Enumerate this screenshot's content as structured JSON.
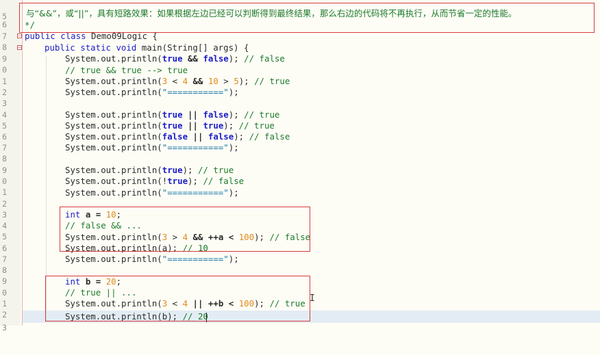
{
  "editor": {
    "lines": [
      {
        "num": "5"
      },
      {
        "num": "6",
        "comment": "与“&&”，或“||”，具有短路效果：如果根据左边已经可以判断得到最终结果，那么右边的代码将不再执行，从而节省一定的性能。"
      },
      {
        "num": "7",
        "text": "*/"
      },
      {
        "num": "8",
        "kw1": "public",
        "kw2": "class",
        "text": "Demo09Logic {"
      },
      {
        "num": "9",
        "kw1": "public",
        "kw2": "static",
        "kw3": "void",
        "text": "main(String[] args) {"
      },
      {
        "num": "0",
        "pre": "System.out.println(",
        "a": "true",
        "op": " && ",
        "b": "false",
        "post": "); ",
        "c": "// false"
      },
      {
        "num": "1",
        "c": "// true && true --> true"
      },
      {
        "num": "2",
        "pre": "System.out.println(",
        "n1": "3",
        "t1": " < ",
        "n2": "4",
        "t2": " && ",
        "n3": "10",
        "t3": " > ",
        "n4": "5",
        "post": "); ",
        "c": "// true"
      },
      {
        "num": "3",
        "pre": "System.out.println(",
        "s": "\"===========\"",
        "post": ");"
      },
      {
        "num": "4"
      },
      {
        "num": "5",
        "pre": "System.out.println(",
        "a": "true",
        "op": " || ",
        "b": "false",
        "post": "); ",
        "c": "// true"
      },
      {
        "num": "6",
        "pre": "System.out.println(",
        "a": "true",
        "op": " || ",
        "b": "true",
        "post": "); ",
        "c": "// true"
      },
      {
        "num": "7",
        "pre": "System.out.println(",
        "a": "false",
        "op": " || ",
        "b": "false",
        "post": "); ",
        "c": "// false"
      },
      {
        "num": "8",
        "pre": "System.out.println(",
        "s": "\"===========\"",
        "post": ");"
      },
      {
        "num": "9"
      },
      {
        "num": "0",
        "pre": "System.out.println(",
        "a": "true",
        "post": "); ",
        "c": "// true"
      },
      {
        "num": "1",
        "pre": "System.out.println(!",
        "a": "true",
        "post": "); ",
        "c": "// false"
      },
      {
        "num": "2",
        "pre": "System.out.println(",
        "s": "\"===========\"",
        "post": ");"
      },
      {
        "num": "3"
      },
      {
        "num": "4",
        "kw1": "int",
        "t1": " a = ",
        "n1": "10",
        "post": ";"
      },
      {
        "num": "5",
        "c": "// false && ..."
      },
      {
        "num": "6",
        "pre": "System.out.println(",
        "n1": "3",
        "t1": " > ",
        "n2": "4",
        "t2": " && ++a < ",
        "n3": "100",
        "post": "); ",
        "c": "// false"
      },
      {
        "num": "7",
        "pre": "System.out.println(a); ",
        "c": "// 10"
      },
      {
        "num": "8",
        "pre": "System.out.println(",
        "s": "\"===========\"",
        "post": ");"
      },
      {
        "num": "9"
      },
      {
        "num": "0",
        "kw1": "int",
        "t1": " b = ",
        "n1": "20",
        "post": ";"
      },
      {
        "num": "1",
        "c": "// true || ..."
      },
      {
        "num": "2",
        "pre": "System.out.println(",
        "n1": "3",
        "t1": " < ",
        "n2": "4",
        "t2": " || ++b < ",
        "n3": "100",
        "post": "); ",
        "c": "// true"
      },
      {
        "num": "3",
        "pre": "System.out.println(b); ",
        "c": "// 20"
      }
    ]
  },
  "colors": {
    "keyword": "#1c1cc8",
    "comment": "#1e7a2a",
    "number": "#e08a1b",
    "string": "#1b78a8",
    "annotation_box": "#d63a3a"
  }
}
